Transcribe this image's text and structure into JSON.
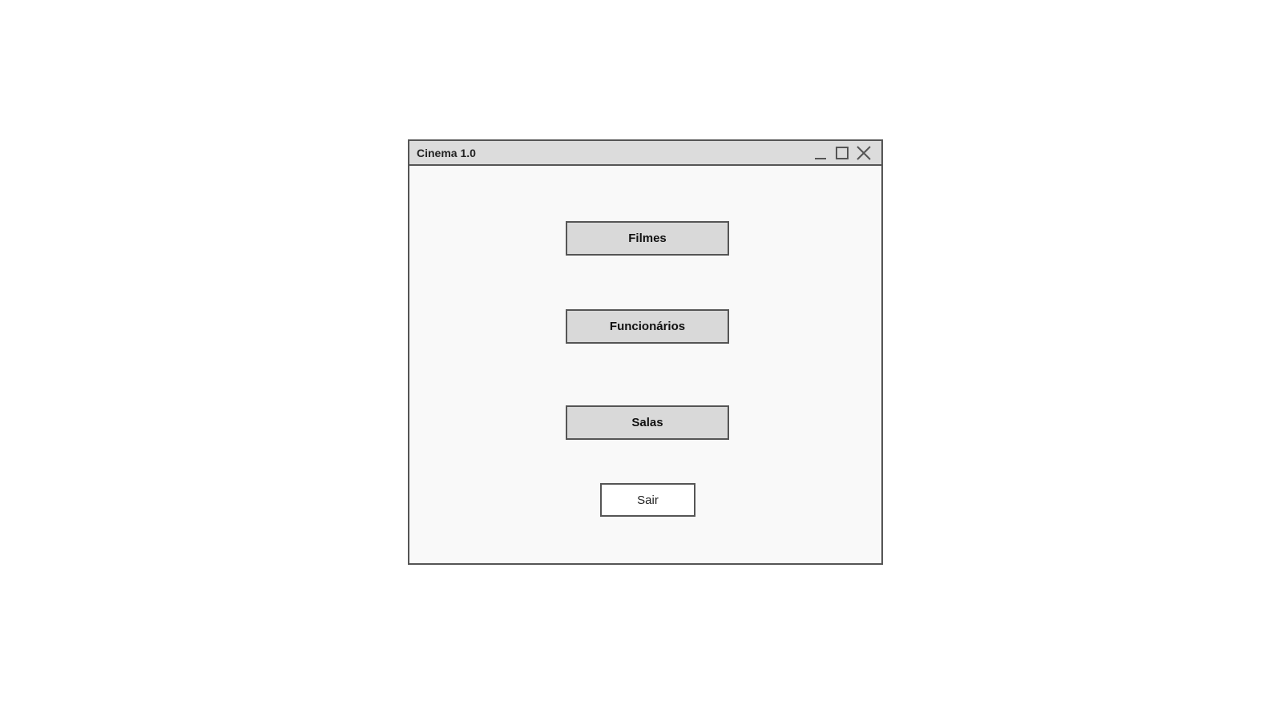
{
  "window": {
    "title": "Cinema 1.0",
    "controls": {
      "minimize_icon": "minimize-icon",
      "maximize_icon": "maximize-icon",
      "close_icon": "close-icon"
    }
  },
  "menu": {
    "filmes_label": "Filmes",
    "funcionarios_label": "Funcionários",
    "salas_label": "Salas",
    "sair_label": "Sair"
  },
  "colors": {
    "titlebar": "#dcdcdc",
    "window_background": "#f9f9f9",
    "border": "#555555",
    "button_primary": "#d9d9d9",
    "button_secondary": "#ffffff"
  }
}
